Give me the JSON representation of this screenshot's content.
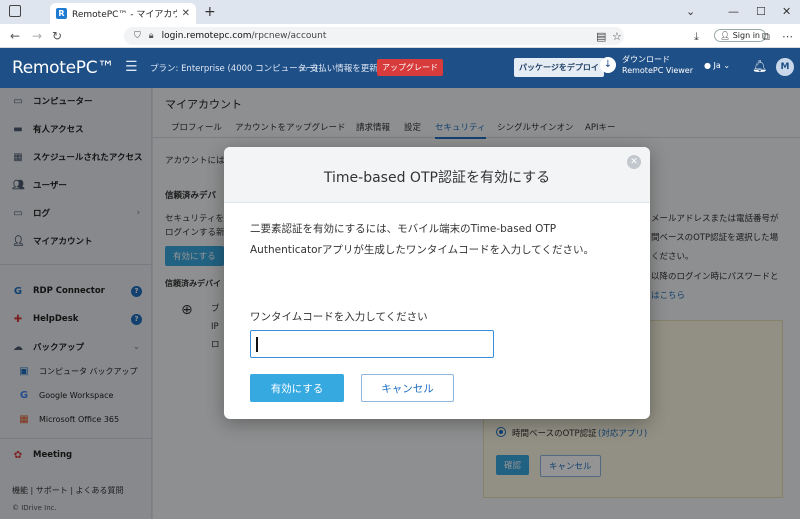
{
  "browser": {
    "tab_title": "RemotePC™ - マイアカウント-セ",
    "url_domain": "login.remotepc.com",
    "url_path": "/rpcnew/account",
    "signin_label": "Sign in"
  },
  "header": {
    "logo": "RemotePC™",
    "plan": "プラン: Enterprise (4000 コンピューター)",
    "payment_update": "支払い情報を更新",
    "upgrade": "アップグレード",
    "deploy_package": "パッケージをデプロイ",
    "download_line1": "ダウンロード",
    "download_line2": "RemotePC Viewer",
    "language": "Ja",
    "avatar": "M"
  },
  "sidebar": {
    "items": [
      {
        "label": "コンピューター"
      },
      {
        "label": "有人アクセス"
      },
      {
        "label": "スケジュールされたアクセス"
      },
      {
        "label": "ユーザー"
      },
      {
        "label": "ログ"
      },
      {
        "label": "マイアカウント"
      },
      {
        "label": "RDP Connector"
      },
      {
        "label": "HelpDesk"
      },
      {
        "label": "バックアップ"
      },
      {
        "label": "コンピュータ バックアップ"
      },
      {
        "label": "Google Workspace"
      },
      {
        "label": "Microsoft Office 365"
      },
      {
        "label": "Meeting"
      }
    ],
    "footer": "機能  |  サポート  |  よくある質問",
    "copyright": "© IDrive Inc."
  },
  "content": {
    "page_title": "マイアカウント",
    "tabs": [
      "プロフィール",
      "アカウントをアップグレード",
      "請求情報",
      "設定",
      "セキュリティ",
      "シングルサインオン",
      "APIキー"
    ],
    "bg_text_1": "アカウントには",
    "bg_heading_trusted": "信頼済みデバ",
    "bg_text_2": "セキュリティを",
    "bg_text_3": "ログインする新",
    "bg_enable_btn": "有効にする",
    "bg_trusted_device": "信頼済みデバイ",
    "bg_device_name": "ブ",
    "bg_ip": "IP",
    "bg_log": "ロ",
    "bg_right_1": "メールアドレスまたは電話番号が",
    "bg_right_2": "間ベースのOTP認証を選択した場",
    "bg_right_3": "ください。",
    "bg_right_4": "以降のログイン時にパスワードと",
    "bg_right_link": "はこちら",
    "otp_option": "時間ベースのOTP認証",
    "otp_option_link": "(対応アプリ)",
    "confirm_btn": "確認",
    "cancel_btn": "キャンセル"
  },
  "modal": {
    "title": "Time-based OTP認証を有効にする",
    "description": "二要素認証を有効にするには、モバイル端末のTime-based OTP Authenticatorアプリが生成したワンタイムコードを入力してください。",
    "input_label": "ワンタイムコードを入力してください",
    "input_value": "",
    "enable_button": "有効にする",
    "cancel_button": "キャンセル",
    "close_glyph": "✕"
  }
}
